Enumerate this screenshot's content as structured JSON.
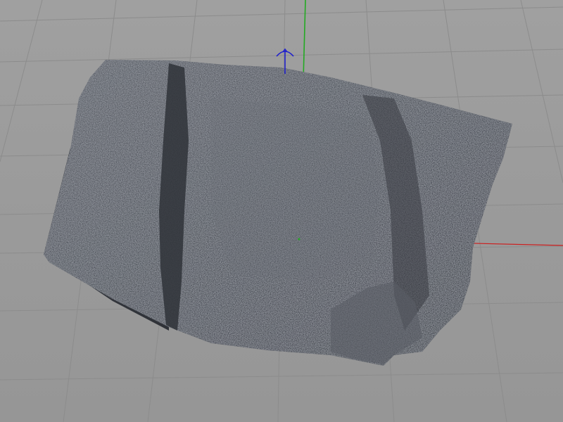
{
  "viewport": {
    "background_color": "#9a9a9a",
    "grid_color": "#8a8a8a",
    "mesh_color": "#4f525a"
  },
  "axes": {
    "x_axis_color": "#cc2020",
    "y_axis_color": "#22aa22",
    "z_axis_color": "#2020cc"
  },
  "scene_object": {
    "name_icon": "rock-mesh-icon"
  }
}
